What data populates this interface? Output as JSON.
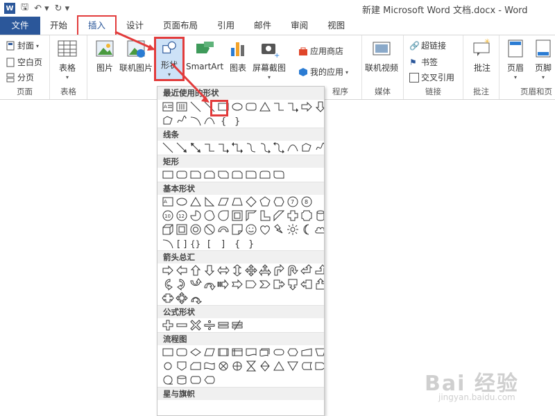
{
  "title": "新建 Microsoft Word 文档.docx - Word",
  "tabs": [
    "文件",
    "开始",
    "插入",
    "设计",
    "页面布局",
    "引用",
    "邮件",
    "审阅",
    "视图"
  ],
  "ribbon": {
    "pages_group": {
      "items": [
        "封面",
        "空白页",
        "分页"
      ],
      "label": "页面"
    },
    "table_group": {
      "button": "表格",
      "label": "表格"
    },
    "illustrations": {
      "picture": "图片",
      "online_picture": "联机图片",
      "shapes": "形状",
      "smartart": "SmartArt",
      "chart": "图表",
      "screenshot": "屏幕截图"
    },
    "apps": {
      "store": "应用商店",
      "my_apps": "我的应用",
      "label": "程序"
    },
    "media": {
      "online_video": "联机视频",
      "label": "媒体"
    },
    "links": {
      "hyperlink": "超链接",
      "bookmark": "书签",
      "cross_ref": "交叉引用",
      "label": "链接"
    },
    "comments": {
      "comment": "批注",
      "label": "批注"
    },
    "header_footer": {
      "header": "页眉",
      "footer": "页脚",
      "label": "页眉和页"
    }
  },
  "shapes_menu": {
    "categories": [
      "最近使用的形状",
      "线条",
      "矩形",
      "基本形状",
      "箭头总汇",
      "公式形状",
      "流程图",
      "星与旗帜"
    ]
  },
  "watermark": {
    "brand": "Bai 经验",
    "url": "jingyan.baidu.com"
  }
}
